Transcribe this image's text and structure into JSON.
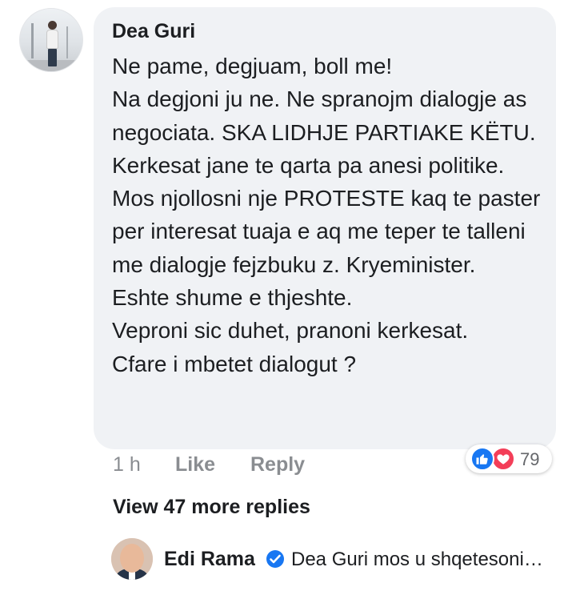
{
  "comment": {
    "author": "Dea Guri",
    "text": "Ne pame, degjuam, boll me!\nNa degjoni ju ne. Ne spranojm dialogje as negociata. SKA LIDHJE PARTIAKE KËTU. Kerkesat jane te qarta pa anesi politike. Mos njollosni nje PROTESTE kaq te paster per interesat tuaja e aq me teper te talleni me dialogje fejzbuku z. Kryeminister.\nEshte shume e thjeshte.\nVeproni sic duhet, pranoni kerkesat.\nCfare i mbetet dialogut ?",
    "time": "1 h",
    "like_label": "Like",
    "reply_label": "Reply",
    "reactions": {
      "count": "79",
      "like_color": "#1877f2",
      "love_color": "#f33e58"
    }
  },
  "view_more_label": "View 47 more replies",
  "reply_preview": {
    "author": "Edi Rama",
    "text": "Dea Guri mos u shqetesoni…"
  }
}
